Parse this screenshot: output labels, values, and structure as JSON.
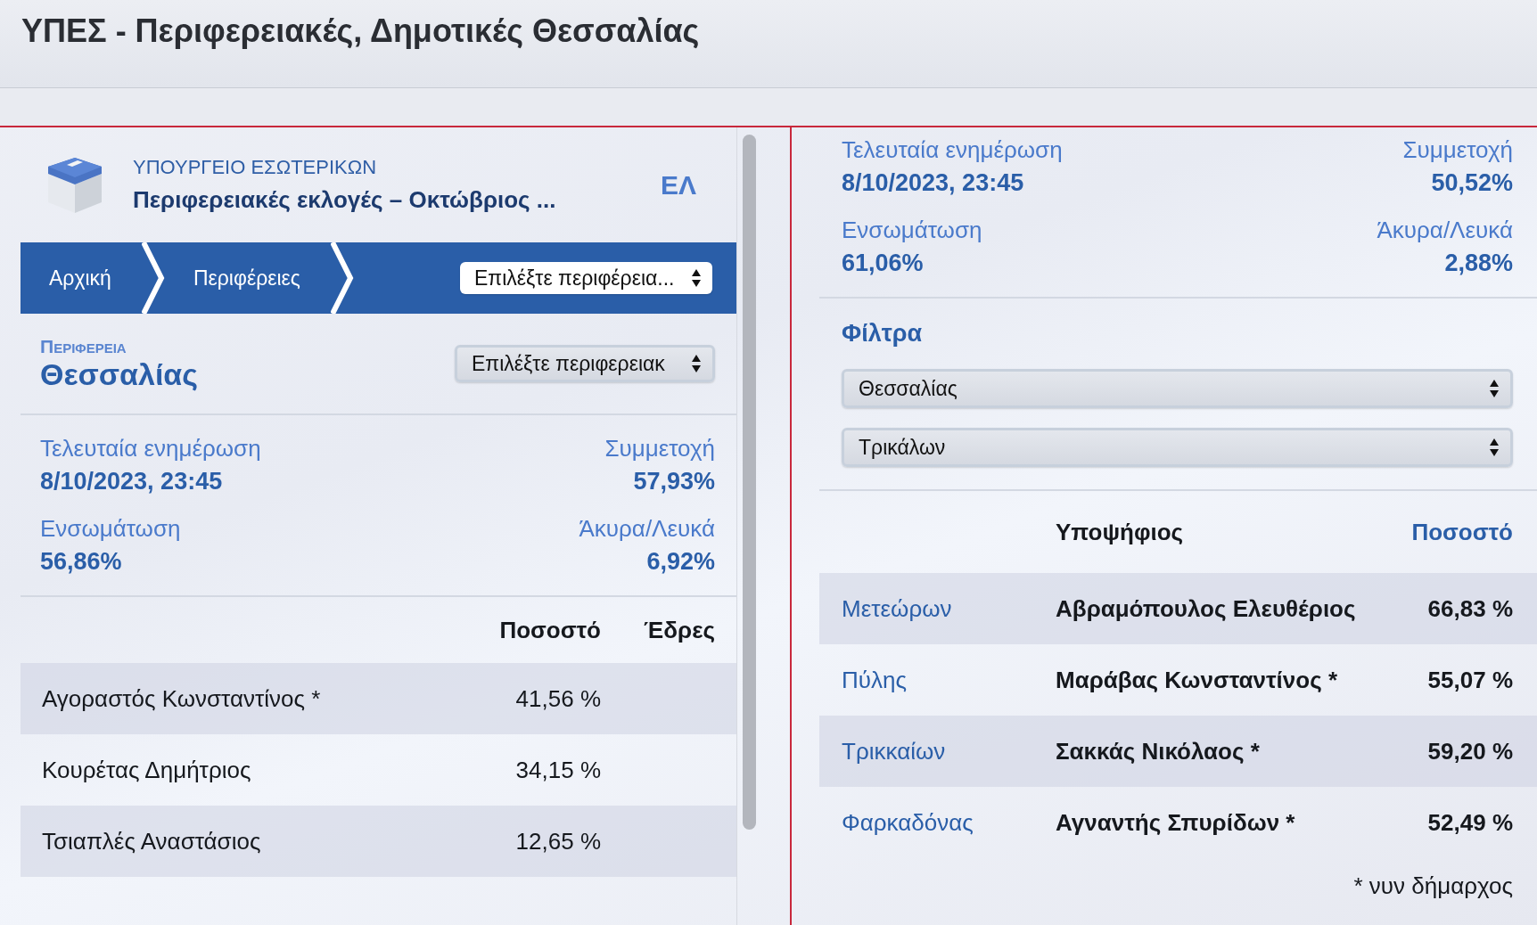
{
  "page_title": "ΥΠΕΣ - Περιφερειακές, Δημοτικές Θεσσαλίας",
  "left": {
    "ministry": "ΥΠΟΥΡΓΕΙΟ ΕΣΩΤΕΡΙΚΩΝ",
    "election": "Περιφερειακές εκλογές – Οκτώβριος ...",
    "language": "ΕΛ",
    "breadcrumbs": [
      {
        "label": "Αρχική"
      },
      {
        "label": "Περιφέρειες"
      }
    ],
    "breadcrumb_select": {
      "value": "Επιλέξτε περιφέρεια..."
    },
    "region": {
      "label": "Περιφερεια",
      "name": "Θεσσαλίας",
      "select": {
        "value": "Επιλέξτε περιφερειακ"
      }
    },
    "stats": [
      {
        "label": "Τελευταία ενημέρωση",
        "value": "8/10/2023, 23:45"
      },
      {
        "label": "Συμμετοχή",
        "value": "57,93%"
      },
      {
        "label": "Ενσωμάτωση",
        "value": "56,86%"
      },
      {
        "label": "Άκυρα/Λευκά",
        "value": "6,92%"
      }
    ],
    "table": {
      "columns": [
        {
          "label": "Ποσοστό"
        },
        {
          "label": "Έδρες"
        }
      ],
      "rows": [
        {
          "name": "Αγοραστός Κωνσταντίνος *",
          "percent": "41,56 %"
        },
        {
          "name": "Κουρέτας Δημήτριος",
          "percent": "34,15 %"
        },
        {
          "name": "Τσιαπλές Αναστάσιος",
          "percent": "12,65 %"
        }
      ]
    }
  },
  "right": {
    "stats": [
      {
        "label": "Τελευταία ενημέρωση",
        "value": "8/10/2023, 23:45"
      },
      {
        "label": "Συμμετοχή",
        "value": "50,52%"
      },
      {
        "label": "Ενσωμάτωση",
        "value": "61,06%"
      },
      {
        "label": "Άκυρα/Λευκά",
        "value": "2,88%"
      }
    ],
    "filters": {
      "title": "Φίλτρα",
      "selects": [
        {
          "value": "Θεσσαλίας"
        },
        {
          "value": "Τρικάλων"
        }
      ]
    },
    "table": {
      "columns": [
        {
          "label": "Υποψήφιος",
          "sorted": false
        },
        {
          "label": "Ποσοστό",
          "sorted": true
        }
      ],
      "rows": [
        {
          "area": "Μετεώρων",
          "candidate": "Αβραμόπουλος Ελευθέριος",
          "percent": "66,83 %"
        },
        {
          "area": "Πύλης",
          "candidate": "Μαράβας Κωνσταντίνος *",
          "percent": "55,07 %"
        },
        {
          "area": "Τρικκαίων",
          "candidate": "Σακκάς Νικόλαος *",
          "percent": "59,20 %"
        },
        {
          "area": "Φαρκαδόνας",
          "candidate": "Αγναντής Σπυρίδων *",
          "percent": "52,49 %"
        }
      ]
    },
    "footnote": "* νυν δήμαρχος"
  }
}
